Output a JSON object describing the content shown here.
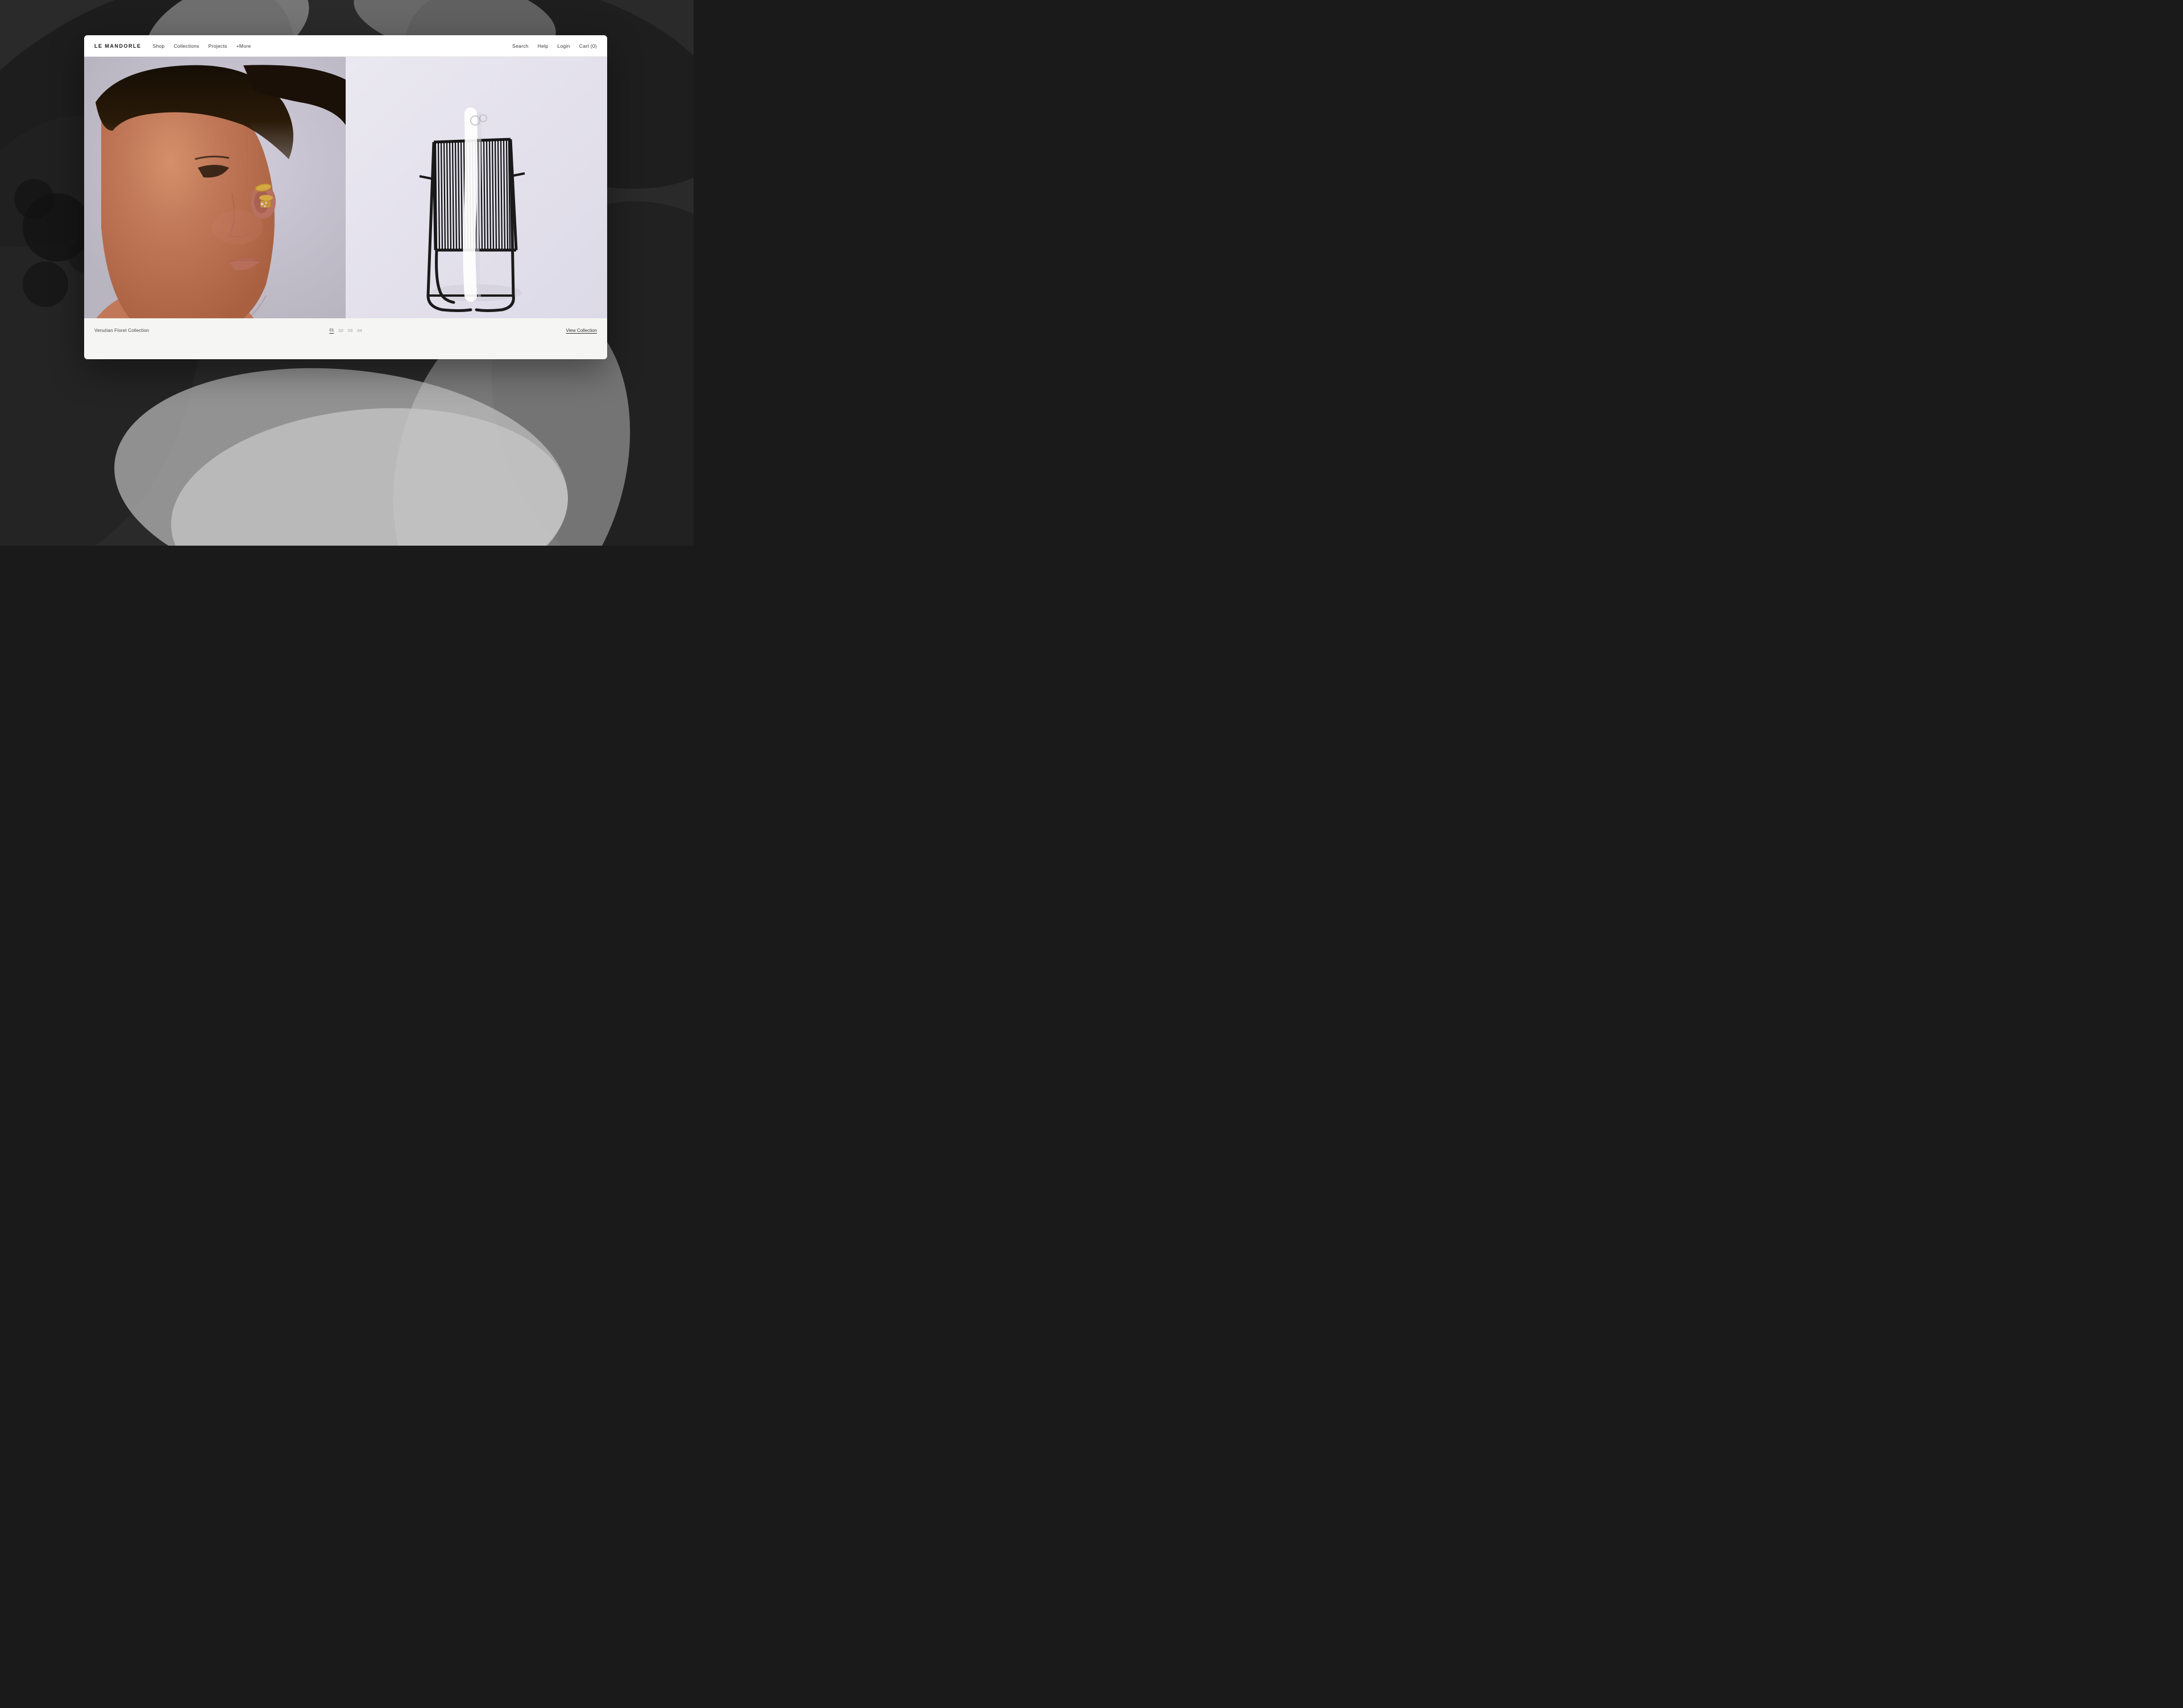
{
  "brand": {
    "logo": "LE MANDORLE"
  },
  "nav": {
    "left_links": [
      {
        "label": "Shop",
        "name": "shop-link"
      },
      {
        "label": "Collections",
        "name": "collections-link"
      },
      {
        "label": "Projects",
        "name": "projects-link"
      },
      {
        "label": "+More",
        "name": "more-link"
      }
    ],
    "right_links": [
      {
        "label": "Search",
        "name": "search-link"
      },
      {
        "label": "Help",
        "name": "help-link"
      },
      {
        "label": "Login",
        "name": "login-link"
      },
      {
        "label": "Cart (0)",
        "name": "cart-link"
      }
    ]
  },
  "hero": {
    "left_alt": "Woman wearing gold earring close-up",
    "right_alt": "Black wire chair with white straps"
  },
  "bottom_bar": {
    "collection_title": "Venutian Floret Collection",
    "slide_indicators": [
      {
        "label": "01",
        "active": true
      },
      {
        "label": "02",
        "active": false
      },
      {
        "label": "03",
        "active": false
      },
      {
        "label": "04",
        "active": false
      }
    ],
    "view_collection_label": "View Collection"
  }
}
